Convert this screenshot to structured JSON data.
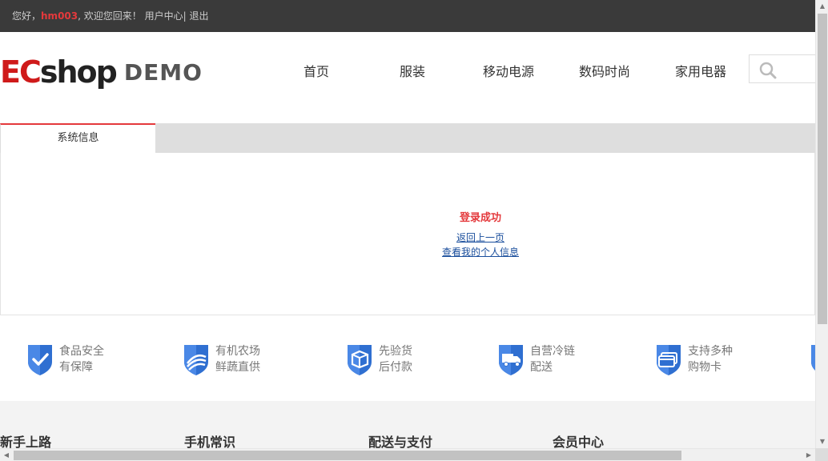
{
  "topbar": {
    "greeting": "您好，",
    "username": "hm003",
    "welcome": ", 欢迎您回来！ ",
    "user_center": "用户中心",
    "separator": "| ",
    "logout": "退出"
  },
  "logo": {
    "part_ec": "EC",
    "part_shop": "shop",
    "demo": "DEMO"
  },
  "nav": {
    "items": [
      "首页",
      "服装",
      "移动电源",
      "数码时尚",
      "家用电器"
    ]
  },
  "tab": {
    "label": "系统信息"
  },
  "message": {
    "title": "登录成功",
    "link_back": "返回上一页",
    "link_profile": "查看我的个人信息"
  },
  "features": [
    {
      "line1": "食品安全",
      "line2": "有保障",
      "icon": "check-shield-icon"
    },
    {
      "line1": "有机农场",
      "line2": "鲜蔬直供",
      "icon": "farm-shield-icon"
    },
    {
      "line1": "先验货",
      "line2": "后付款",
      "icon": "box-shield-icon"
    },
    {
      "line1": "自营冷链",
      "line2": "配送",
      "icon": "truck-shield-icon"
    },
    {
      "line1": "支持多种",
      "line2": "购物卡",
      "icon": "card-shield-icon"
    }
  ],
  "footer": {
    "columns": [
      "新手上路",
      "手机常识",
      "配送与支付",
      "会员中心"
    ]
  },
  "colors": {
    "accent": "#e4393c",
    "topbar_bg": "#3a3a3a",
    "shield_blue": "#2f6fd1"
  }
}
